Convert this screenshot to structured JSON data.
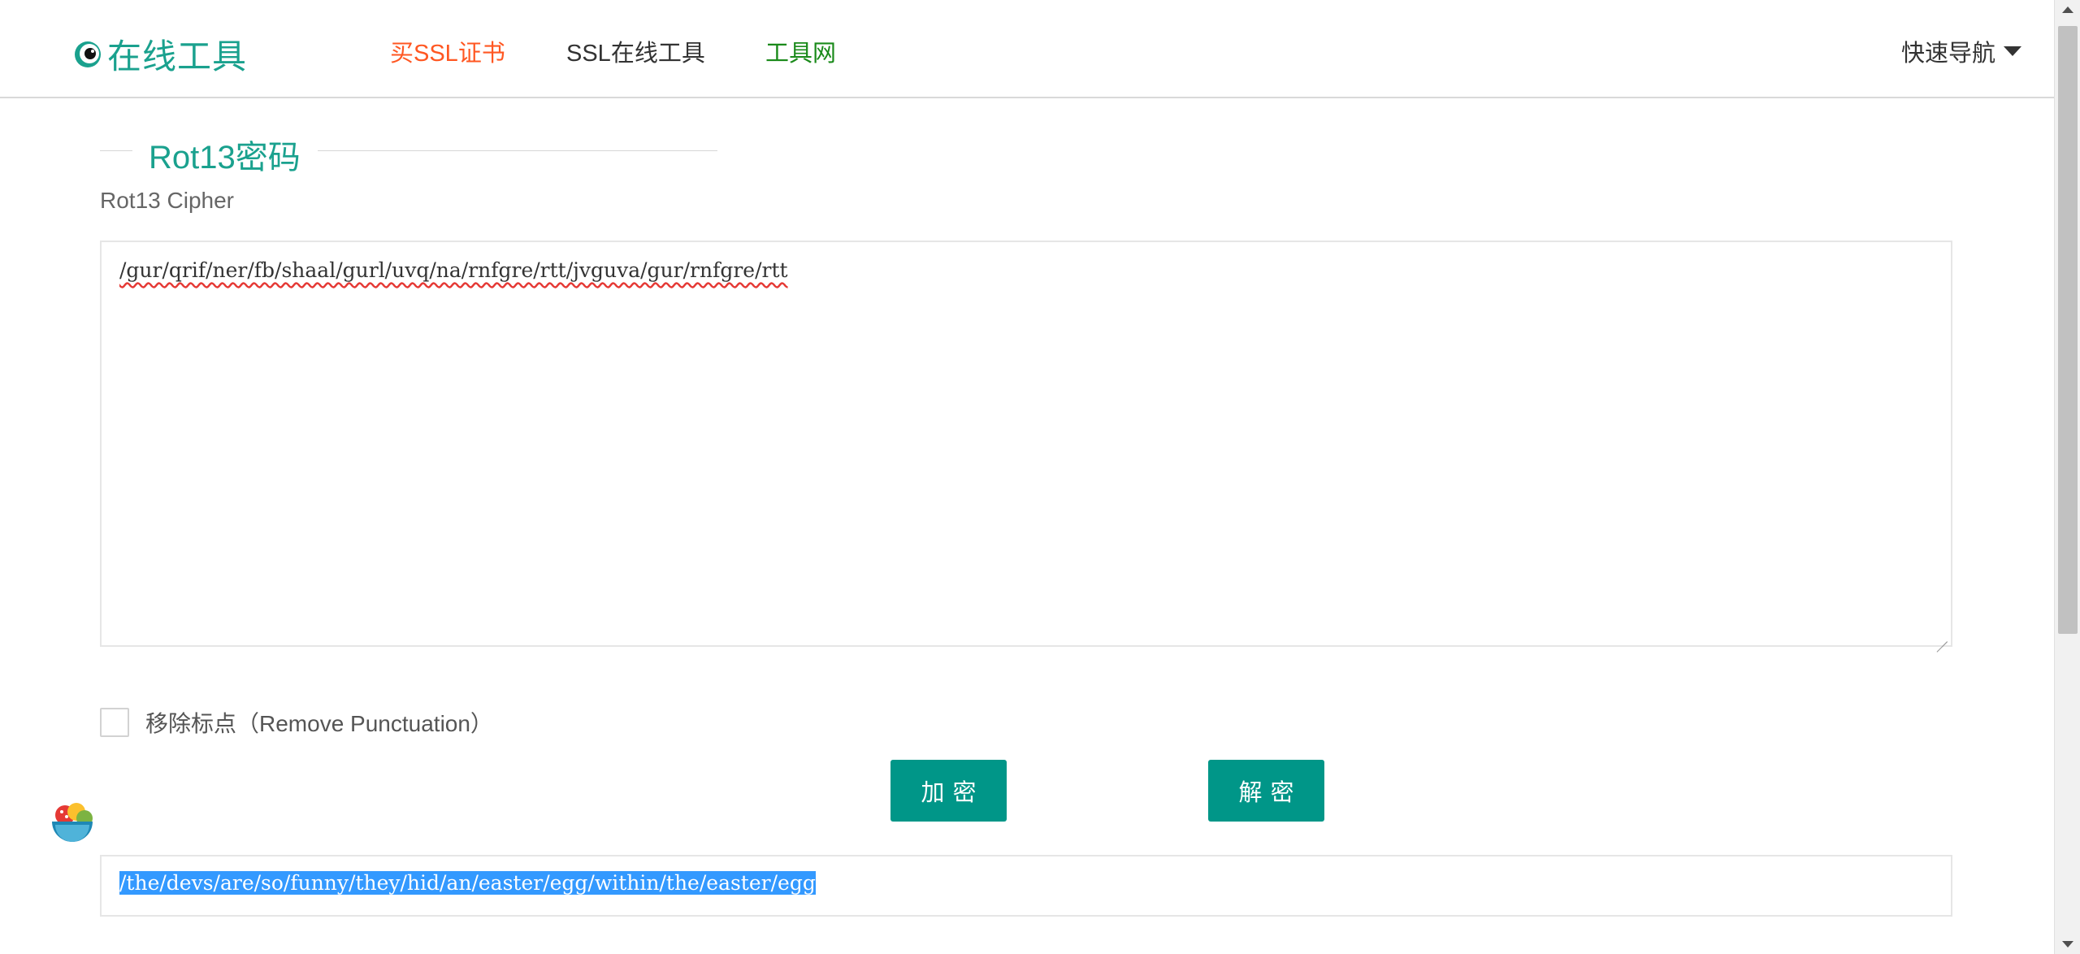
{
  "header": {
    "logo_text": "在线工具",
    "nav": {
      "buy_ssl": "买SSL证书",
      "ssl_tools": "SSL在线工具",
      "tools_net": "工具网"
    },
    "quick_nav": "快速导航"
  },
  "main": {
    "title": "Rot13密码",
    "subtitle": "Rot13 Cipher",
    "input_text": "/gur/qrif/ner/fb/shaal/gurl/uvq/na/rnfgre/rtt/jvguva/gur/rnfgre/rtt",
    "remove_punct_label": "移除标点（Remove Punctuation）",
    "remove_punct_checked": false,
    "encrypt_label": "加密",
    "decrypt_label": "解密",
    "output_text": "/the/devs/are/so/funny/they/hid/an/easter/egg/within/the/easter/egg"
  },
  "colors": {
    "accent": "#009688",
    "brand": "#1aa18e",
    "ssl_link": "#ff5722",
    "tools_link": "#1a8a1a",
    "selection": "#3399ff"
  },
  "icons": {
    "logo": "eye-logo-icon",
    "quick_nav": "caret-down-icon",
    "mascot": "mascot-bowl-icon"
  }
}
